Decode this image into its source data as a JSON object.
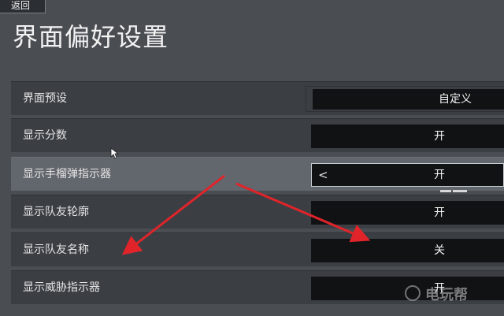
{
  "back_label": "返回",
  "title": "界面偏好设置",
  "settings": [
    {
      "label": "界面预设",
      "value": "自定义"
    },
    {
      "label": "显示分数",
      "value": "开"
    },
    {
      "label": "显示手榴弹指示器",
      "value": "开"
    },
    {
      "label": "显示队友轮廓",
      "value": "开"
    },
    {
      "label": "显示队友名称",
      "value": "关"
    },
    {
      "label": "显示威胁指示器",
      "value": "开"
    }
  ],
  "watermark_text": "电玩帮",
  "colors": {
    "background": "#4a4d52",
    "row": "#3b3f44",
    "row_active": "#62666d",
    "value_box": "#111214",
    "arrow": "#e0242a"
  },
  "icons": {
    "back": "back-button",
    "prev": "chevron-left-icon",
    "cursor": "mouse-cursor-icon"
  }
}
